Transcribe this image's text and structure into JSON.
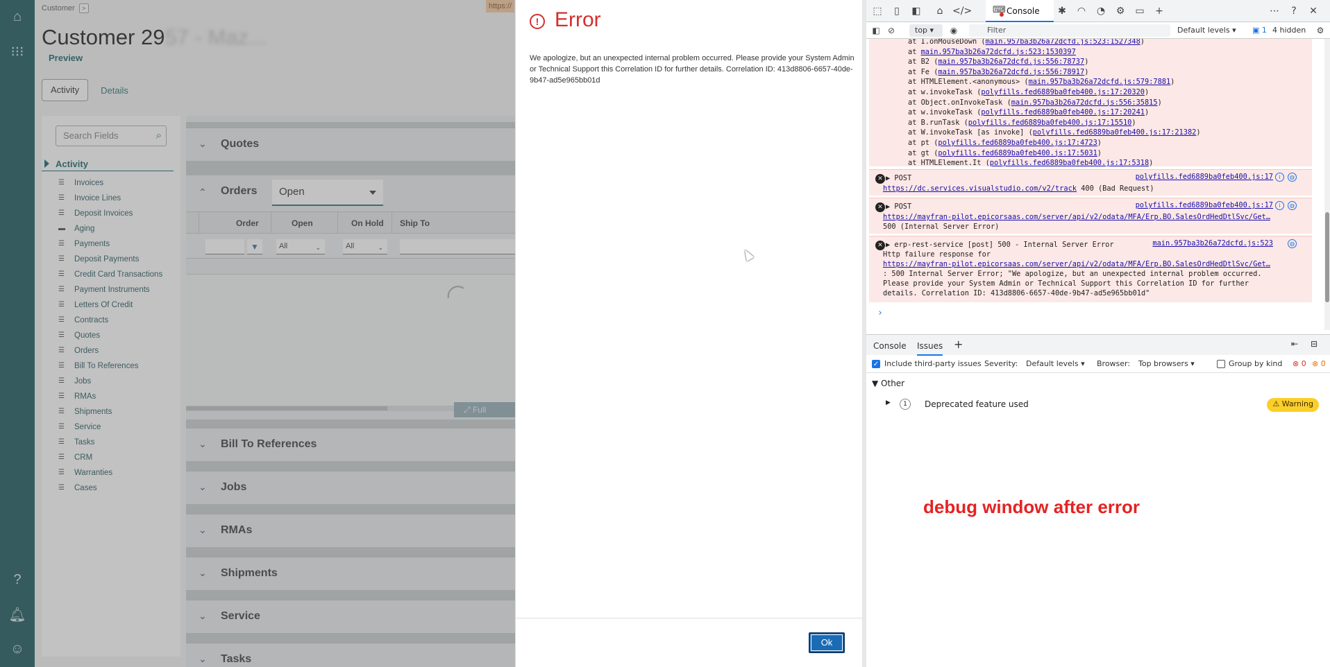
{
  "breadcrumb": {
    "label": "Customer",
    "chevron": ">"
  },
  "url_chip": "https://",
  "customer": {
    "title_visible": "Customer 29",
    "title_blurred": "57 - Maz...",
    "preview_label": "Preview"
  },
  "tabs": [
    {
      "label": "Activity"
    },
    {
      "label": "Details"
    }
  ],
  "search": {
    "placeholder": "Search Fields"
  },
  "activity_label": "Activity",
  "nav_items": [
    "Invoices",
    "Invoice Lines",
    "Deposit Invoices",
    "Aging",
    "Payments",
    "Deposit Payments",
    "Credit Card Transactions",
    "Payment Instruments",
    "Letters Of Credit",
    "Contracts",
    "Quotes",
    "Orders",
    "Bill To References",
    "Jobs",
    "RMAs",
    "Shipments",
    "Service",
    "Tasks",
    "CRM",
    "Warranties",
    "Cases"
  ],
  "sections": {
    "quotes": "Quotes",
    "orders": "Orders",
    "bill_to": "Bill To References",
    "jobs": "Jobs",
    "rmas": "RMAs",
    "shipments": "Shipments",
    "service": "Service",
    "tasks": "Tasks"
  },
  "orders": {
    "filter_value": "Open",
    "columns": {
      "order": "Order",
      "open": "Open",
      "on_hold": "On Hold",
      "ship_to": "Ship To"
    },
    "filters": {
      "open": "All",
      "on_hold": "All"
    },
    "full_label": "Full"
  },
  "dialog": {
    "title": "Error",
    "message": "We apologize, but an unexpected internal problem occurred. Please provide your System Admin or Technical Support this Correlation ID for further details. Correlation ID: 413d8806-6657-40de-9b47-ad5e965bb01d",
    "ok_label": "Ok"
  },
  "devtools": {
    "console_tab": "Console",
    "context": "top",
    "filter_placeholder": "Filter",
    "levels": "Default levels",
    "issues_count": "1",
    "hidden": "4 hidden",
    "stack": [
      {
        "pre": "at I.onMouseDown (",
        "link": "main.957ba3b26a72dcfd.js:523:1527348",
        "post": ")"
      },
      {
        "pre": "at ",
        "link": "main.957ba3b26a72dcfd.js:523:1530397",
        "post": ""
      },
      {
        "pre": "at B2 (",
        "link": "main.957ba3b26a72dcfd.js:556:78737",
        "post": ")"
      },
      {
        "pre": "at Fe (",
        "link": "main.957ba3b26a72dcfd.js:556:78917",
        "post": ")"
      },
      {
        "pre": "at HTMLElement.<anonymous> (",
        "link": "main.957ba3b26a72dcfd.js:579:7881",
        "post": ")"
      },
      {
        "pre": "at w.invokeTask (",
        "link": "polyfills.fed6889ba0feb400.js:17:20320",
        "post": ")"
      },
      {
        "pre": "at Object.onInvokeTask (",
        "link": "main.957ba3b26a72dcfd.js:556:35815",
        "post": ")"
      },
      {
        "pre": "at w.invokeTask (",
        "link": "polyfills.fed6889ba0feb400.js:17:20241",
        "post": ")"
      },
      {
        "pre": "at B.runTask (",
        "link": "polyfills.fed6889ba0feb400.js:17:15510",
        "post": ")"
      },
      {
        "pre": "at W.invokeTask [as invoke] (",
        "link": "polyfills.fed6889ba0feb400.js:17:21382",
        "post": ")"
      },
      {
        "pre": "at pt (",
        "link": "polyfills.fed6889ba0feb400.js:17:4723",
        "post": ")"
      },
      {
        "pre": "at gt (",
        "link": "polyfills.fed6889ba0feb400.js:17:5031",
        "post": ")"
      },
      {
        "pre": "at HTMLElement.It (",
        "link": "polyfills.fed6889ba0feb400.js:17:5318",
        "post": ")"
      }
    ],
    "post1": {
      "method": "POST",
      "source": "polyfills.fed6889ba0feb400.js:17",
      "url": "https://dc.services.visualstudio.com/v2/track",
      "status": "400 (Bad Request)"
    },
    "post2": {
      "method": "POST",
      "source": "polyfills.fed6889ba0feb400.js:17",
      "url": "https://mayfran-pilot.epicorsaas.com/server/api/v2/odata/MFA/Erp.BO.SalesOrdHedDtlSvc/Get…",
      "status": "500 (Internal Server Error)"
    },
    "rest_error": {
      "title": "erp-rest-service [post] 500 - Internal Server Error",
      "source": "main.957ba3b26a72dcfd.js:523",
      "line1": "Http failure response for",
      "url": "https://mayfran-pilot.epicorsaas.com/server/api/v2/odata/MFA/Erp.BO.SalesOrdHedDtlSvc/Get…",
      "line3": ": 500 Internal Server Error; \"We apologize, but an unexpected internal problem occurred.",
      "line4": "Please provide your System Admin or Technical Support this Correlation ID for further",
      "line5": "details. Correlation ID: 413d8806-6657-40de-9b47-ad5e965bb01d\""
    },
    "drawer_tabs": {
      "console": "Console",
      "issues": "Issues"
    },
    "issues_bar": {
      "third_party": "Include third-party issues",
      "severity_label": "Severity:",
      "severity_value": "Default levels",
      "browser_label": "Browser:",
      "browser_value": "Top browsers",
      "group": "Group by kind",
      "err_count": "0",
      "warn_count": "0"
    },
    "other_label": "Other",
    "issue": {
      "count": "1",
      "label": "Deprecated feature used",
      "badge": "Warning"
    }
  },
  "annotation": "debug window after error"
}
